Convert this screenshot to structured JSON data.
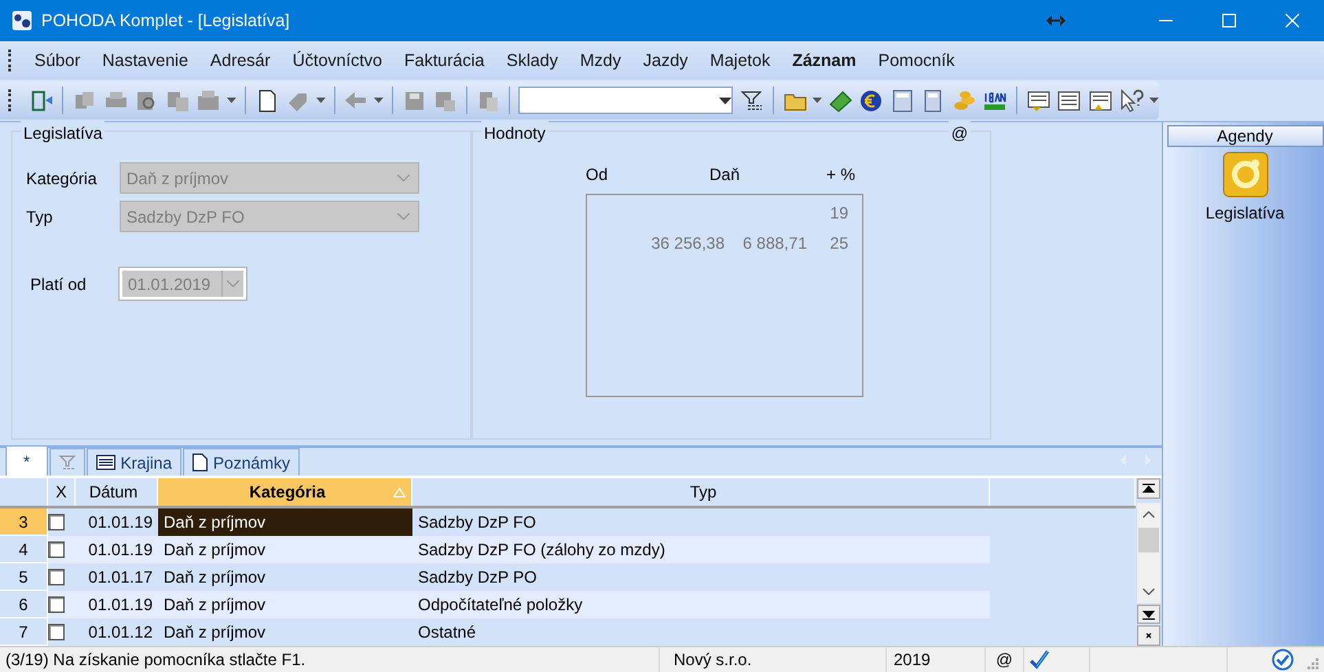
{
  "window": {
    "title": "POHODA Komplet - [Legislatíva]"
  },
  "menu": [
    {
      "label": "Súbor",
      "active": false
    },
    {
      "label": "Nastavenie",
      "active": false
    },
    {
      "label": "Adresár",
      "active": false
    },
    {
      "label": "Účtovníctvo",
      "active": false
    },
    {
      "label": "Fakturácia",
      "active": false
    },
    {
      "label": "Sklady",
      "active": false
    },
    {
      "label": "Mzdy",
      "active": false
    },
    {
      "label": "Jazdy",
      "active": false
    },
    {
      "label": "Majetok",
      "active": false
    },
    {
      "label": "Záznam",
      "active": true
    },
    {
      "label": "Pomocník",
      "active": false
    }
  ],
  "legislativa": {
    "title": "Legislatíva",
    "fields": [
      {
        "kind": "combo",
        "label": "Kategória",
        "value": "Daň z príjmov",
        "disabled": true
      },
      {
        "kind": "combo",
        "label": "Typ",
        "value": "Sadzby DzP FO",
        "disabled": true
      },
      {
        "kind": "date",
        "label": "Platí od",
        "value": "01.01.2019",
        "disabled": true
      }
    ]
  },
  "hodnoty": {
    "title": "Hodnoty",
    "marker": "@",
    "columns": [
      "Od",
      "Daň",
      "+ %"
    ],
    "rows": [
      [
        "",
        "",
        "19"
      ],
      [
        "36 256,38",
        "6 888,71",
        "25"
      ]
    ]
  },
  "tabs": [
    {
      "kind": "text",
      "label": "*",
      "selected": true
    },
    {
      "kind": "filter",
      "selected": false
    },
    {
      "kind": "table",
      "label": "Krajina",
      "selected": false
    },
    {
      "kind": "note",
      "label": "Poznámky",
      "selected": false
    }
  ],
  "grid": {
    "columns": [
      {
        "label": "X",
        "sorted": false
      },
      {
        "label": "Dátum",
        "sorted": false
      },
      {
        "label": "Kategória",
        "sorted": true
      },
      {
        "label": "Typ",
        "sorted": false
      }
    ],
    "rows": [
      {
        "number": "3",
        "checked": false,
        "date": "01.01.19",
        "category": "Daň z príjmov",
        "type": "Sadzby DzP FO",
        "selected": true
      },
      {
        "number": "4",
        "checked": false,
        "date": "01.01.19",
        "category": "Daň z príjmov",
        "type": "Sadzby DzP FO (zálohy zo mzdy)",
        "selected": false
      },
      {
        "number": "5",
        "checked": false,
        "date": "01.01.17",
        "category": "Daň z príjmov",
        "type": "Sadzby DzP PO",
        "selected": false
      },
      {
        "number": "6",
        "checked": false,
        "date": "01.01.19",
        "category": "Daň z príjmov",
        "type": "Odpočítateľné položky",
        "selected": false
      },
      {
        "number": "7",
        "checked": false,
        "date": "01.01.12",
        "category": "Daň z príjmov",
        "type": "Ostatné",
        "selected": false
      }
    ]
  },
  "agendy": {
    "title": "Agendy",
    "items": [
      {
        "label": "Legislatíva"
      }
    ]
  },
  "status_bar": {
    "message": "(3/19) Na získanie pomocníka stlačte F1.",
    "company": "Nový s.r.o.",
    "year": "2019",
    "marker": "@"
  }
}
